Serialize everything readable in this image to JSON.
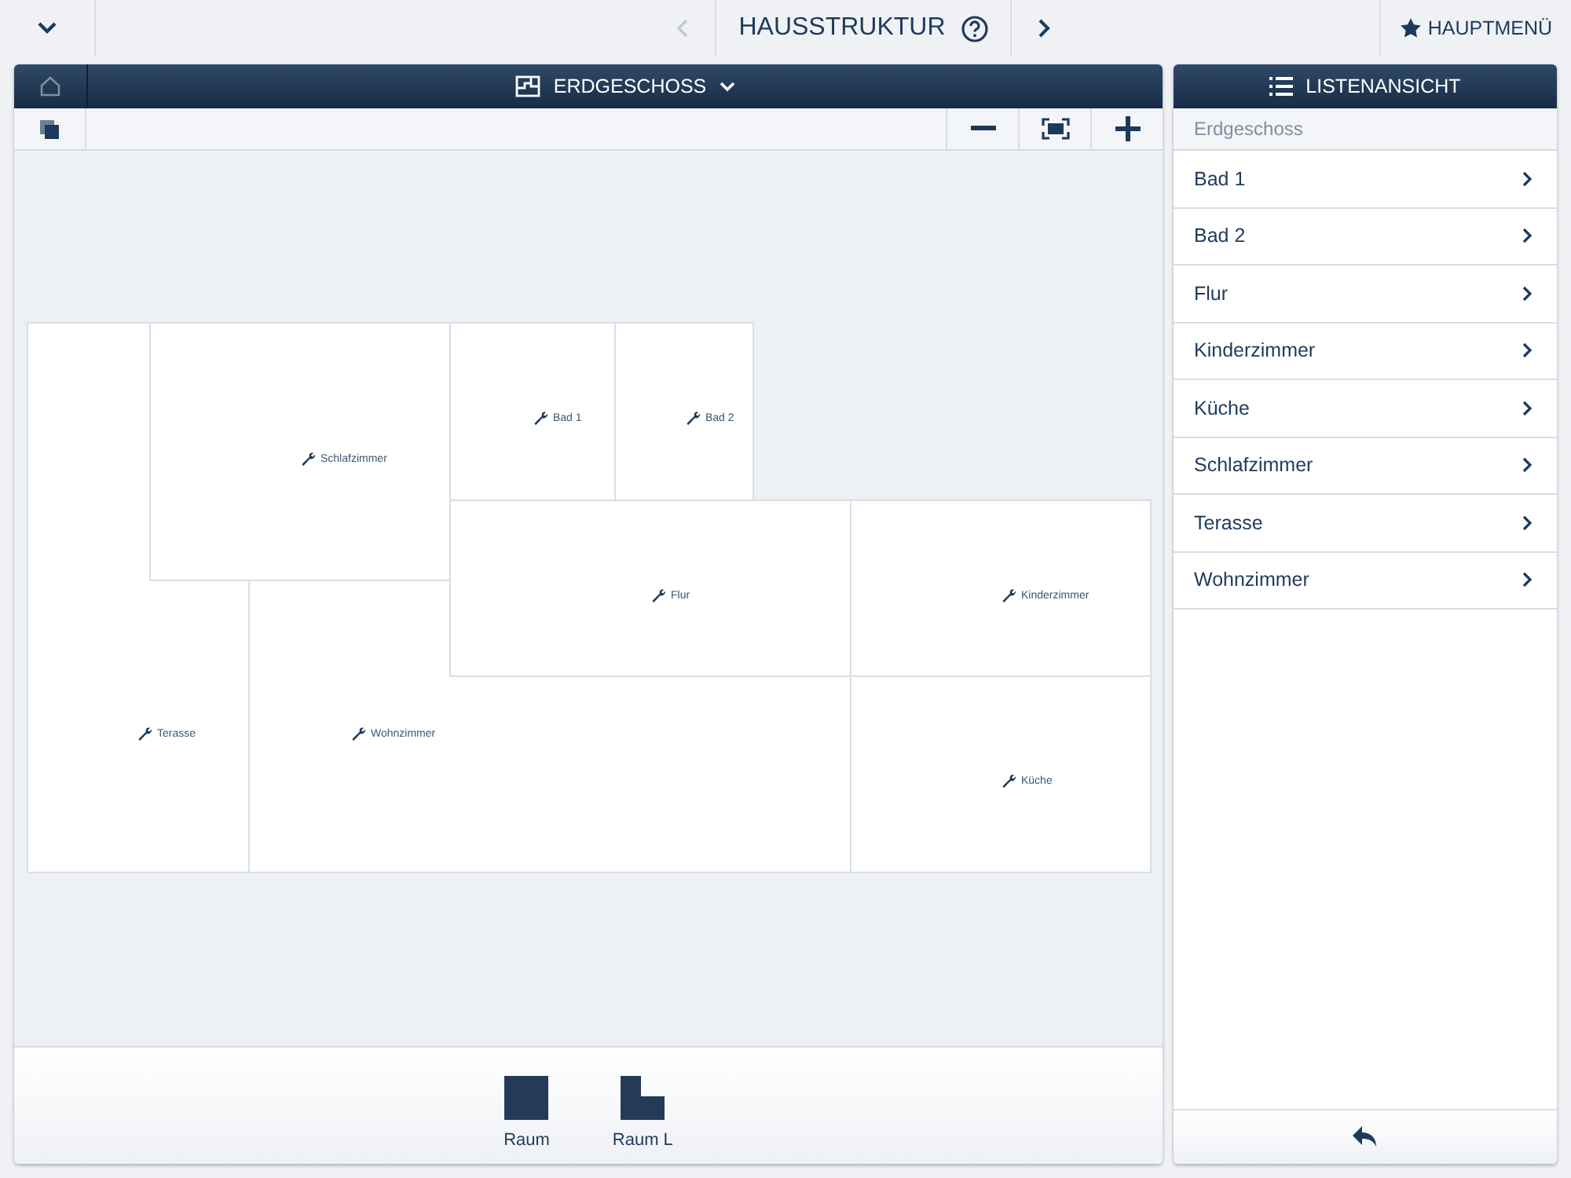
{
  "top_bar": {
    "title": "HAUSSTRUKTUR",
    "main_menu": "HAUPTMENÜ"
  },
  "plan_panel": {
    "floor": "ERDGESCHOSS"
  },
  "rooms": [
    {
      "name": "Terasse"
    },
    {
      "name": "Schlafzimmer"
    },
    {
      "name": "Wohnzimmer"
    },
    {
      "name": "Bad 1"
    },
    {
      "name": "Bad 2"
    },
    {
      "name": "Flur"
    },
    {
      "name": "Kinderzimmer"
    },
    {
      "name": "Küche"
    }
  ],
  "tray": [
    {
      "label": "Raum",
      "kind": "square"
    },
    {
      "label": "Raum L",
      "kind": "l-shape"
    }
  ],
  "list_panel": {
    "title": "LISTENANSICHT",
    "section": "Erdgeschoss",
    "items": [
      "Bad 1",
      "Bad 2",
      "Flur",
      "Kinderzimmer",
      "Küche",
      "Schlafzimmer",
      "Terasse",
      "Wohnzimmer"
    ]
  }
}
